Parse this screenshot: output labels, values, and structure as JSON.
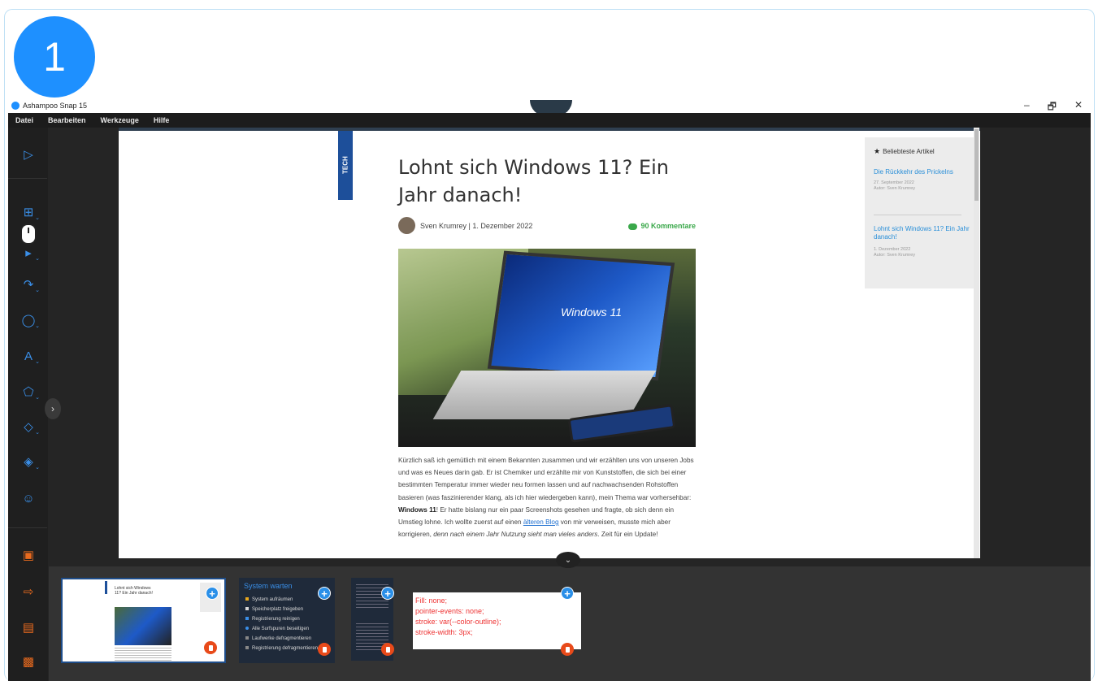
{
  "step_badge": "1",
  "window": {
    "title": "Ashampoo Snap 15",
    "minimize": "–",
    "restore": "🗗",
    "close": "✕"
  },
  "menu": [
    "Datei",
    "Bearbeiten",
    "Werkzeuge",
    "Hilfe"
  ],
  "article": {
    "tag": "TECH",
    "title": "Lohnt sich Windows 11? Ein Jahr danach!",
    "author_line": "Sven Krumrey | 1. Dezember 2022",
    "comments": "90 Kommentare",
    "hero_label": "Windows 11",
    "body_1": "Kürzlich saß ich gemütlich mit einem Bekannten zusammen und wir erzählten uns von unseren Jobs und was es Neues darin gab. Er ist Chemiker und erzählte mir von Kunststoffen, die sich bei einer bestimmten Temperatur immer wieder neu formen lassen und auf nachwachsenden Rohstoffen basieren (was faszinierender klang, als ich hier wiedergeben kann), mein Thema war vorhersehbar: ",
    "body_bold": "Windows 11",
    "body_2": "! Er hatte bislang nur ein paar Screenshots gesehen und fragte, ob sich denn ein Umstieg lohne. Ich wollte zuerst auf einen ",
    "body_link": "älteren Blog",
    "body_3": " von mir verweisen, musste mich aber korrigieren, ",
    "body_italic": "denn nach einem Jahr Nutzung sieht man vieles anders",
    "body_4": ". Zeit für ein Update!"
  },
  "sidebar": {
    "heading": "Beliebteste Artikel",
    "items": [
      {
        "title": "Die Rückkehr des Prickelns",
        "date": "27. September 2022",
        "author": "Autor: Sven Krumrey"
      },
      {
        "title": "Lohnt sich Windows 11? Ein Jahr danach!",
        "date": "1. Dezember 2022",
        "author": "Autor: Sven Krumrey"
      }
    ]
  },
  "tray": {
    "thumb1_title": "Lohnt sich Windows 11? Ein Jahr danach!",
    "thumb2_title": "System warten",
    "thumb2_items": [
      {
        "label": "System aufräumen",
        "color": "#e8a81e"
      },
      {
        "label": "Speicherplatz freigeben",
        "color": "#d8d8d8"
      },
      {
        "label": "Registrierung reinigen",
        "color": "#3a8fe8"
      },
      {
        "label": "Alle Surfspuren beseitigen",
        "color": "#3a8fe8"
      },
      {
        "label": "Laufwerke defragmentieren",
        "color": "#888888"
      },
      {
        "label": "Registrierung defragmentieren",
        "color": "#888888"
      }
    ],
    "code_lines": [
      "Fill: none;",
      "pointer-events: none;",
      "stroke: var(--color-outline);",
      "stroke-width: 3px;"
    ]
  },
  "icons": {
    "select": "cursor-arrow-icon",
    "crop": "crop-icon",
    "mouse": "mouse-icon",
    "arrow": "curved-arrow-icon",
    "blur": "drop-icon",
    "text": "text-style-icon",
    "shape": "pentagon-icon",
    "eraser": "eraser-icon",
    "fill": "paint-bucket-icon",
    "emoji": "smiley-icon",
    "save": "save-icon",
    "export": "export-icon",
    "clipboard": "clipboard-icon",
    "delete": "trash-icon"
  },
  "colors": {
    "accent": "#1e90ff",
    "tool_blue": "#3a8fe8",
    "tool_orange": "#e86a1e",
    "comments_green": "#3aa84a",
    "tag_blue": "#1d4f9a"
  }
}
